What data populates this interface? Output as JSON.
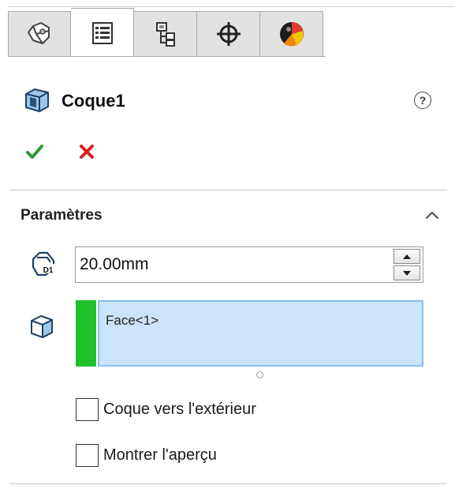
{
  "tabs": [
    {
      "icon": "feature-manager-icon",
      "active": false
    },
    {
      "icon": "property-manager-icon",
      "active": true
    },
    {
      "icon": "configuration-manager-icon",
      "active": false
    },
    {
      "icon": "dimxpert-manager-icon",
      "active": false
    },
    {
      "icon": "display-manager-icon",
      "active": false
    }
  ],
  "header": {
    "title": "Coque1",
    "icon": "shell-feature-icon",
    "help_symbol": "?"
  },
  "actions": {
    "ok_icon": "checkmark-icon",
    "cancel_icon": "close-icon"
  },
  "parameters": {
    "title": "Paramètres",
    "thickness": {
      "icon": "thickness-d1-icon",
      "value": "20.00mm"
    },
    "faces": {
      "icon": "face-select-icon",
      "items": [
        "Face<1>"
      ]
    },
    "options": [
      {
        "label": "Coque vers l'extérieur",
        "checked": false
      },
      {
        "label": "Montrer l'aperçu",
        "checked": false
      }
    ]
  },
  "colors": {
    "selection_bg": "#cbe3fb",
    "selection_marker": "#21c12d",
    "ok": "#2c9a2c",
    "cancel": "#d42020"
  }
}
